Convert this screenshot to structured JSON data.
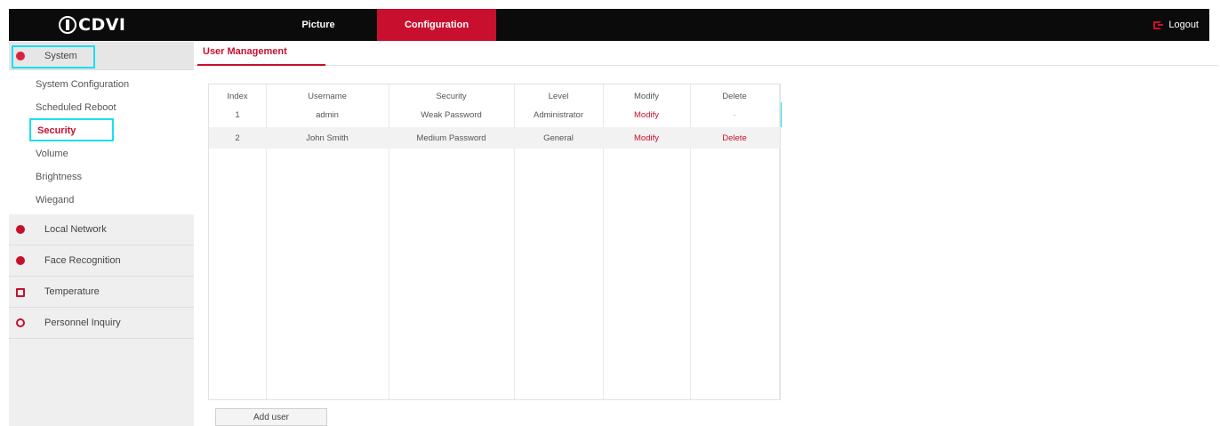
{
  "header": {
    "logo_text": "CDVI",
    "tabs": [
      {
        "label": "Picture"
      },
      {
        "label": "Configuration"
      }
    ],
    "logout_label": "Logout"
  },
  "sidebar": {
    "system": {
      "label": "System",
      "items": [
        {
          "label": "System Configuration"
        },
        {
          "label": "Scheduled Reboot"
        },
        {
          "label": "Security"
        },
        {
          "label": "Volume"
        },
        {
          "label": "Brightness"
        },
        {
          "label": "Wiegand"
        }
      ]
    },
    "sections": [
      {
        "label": "Local Network",
        "icon": "globe-icon"
      },
      {
        "label": "Face Recognition",
        "icon": "face-icon"
      },
      {
        "label": "Temperature",
        "icon": "monitor-icon"
      },
      {
        "label": "Personnel Inquiry",
        "icon": "info-icon"
      }
    ]
  },
  "main": {
    "tab_label": "User Management",
    "table": {
      "columns": [
        "Index",
        "Username",
        "Security",
        "Level",
        "Modify",
        "Delete"
      ],
      "rows": [
        {
          "index": "1",
          "username": "admin",
          "security": "Weak Password",
          "level": "Administrator",
          "modify": "Modify",
          "delete": "-"
        },
        {
          "index": "2",
          "username": "John Smith",
          "security": "Medium Password",
          "level": "General",
          "modify": "Modify",
          "delete": "Delete"
        }
      ]
    },
    "add_user_label": "Add user"
  },
  "colors": {
    "accent": "#c8102e",
    "topbar": "#0b0b0b",
    "highlight": "#18e0f0"
  }
}
